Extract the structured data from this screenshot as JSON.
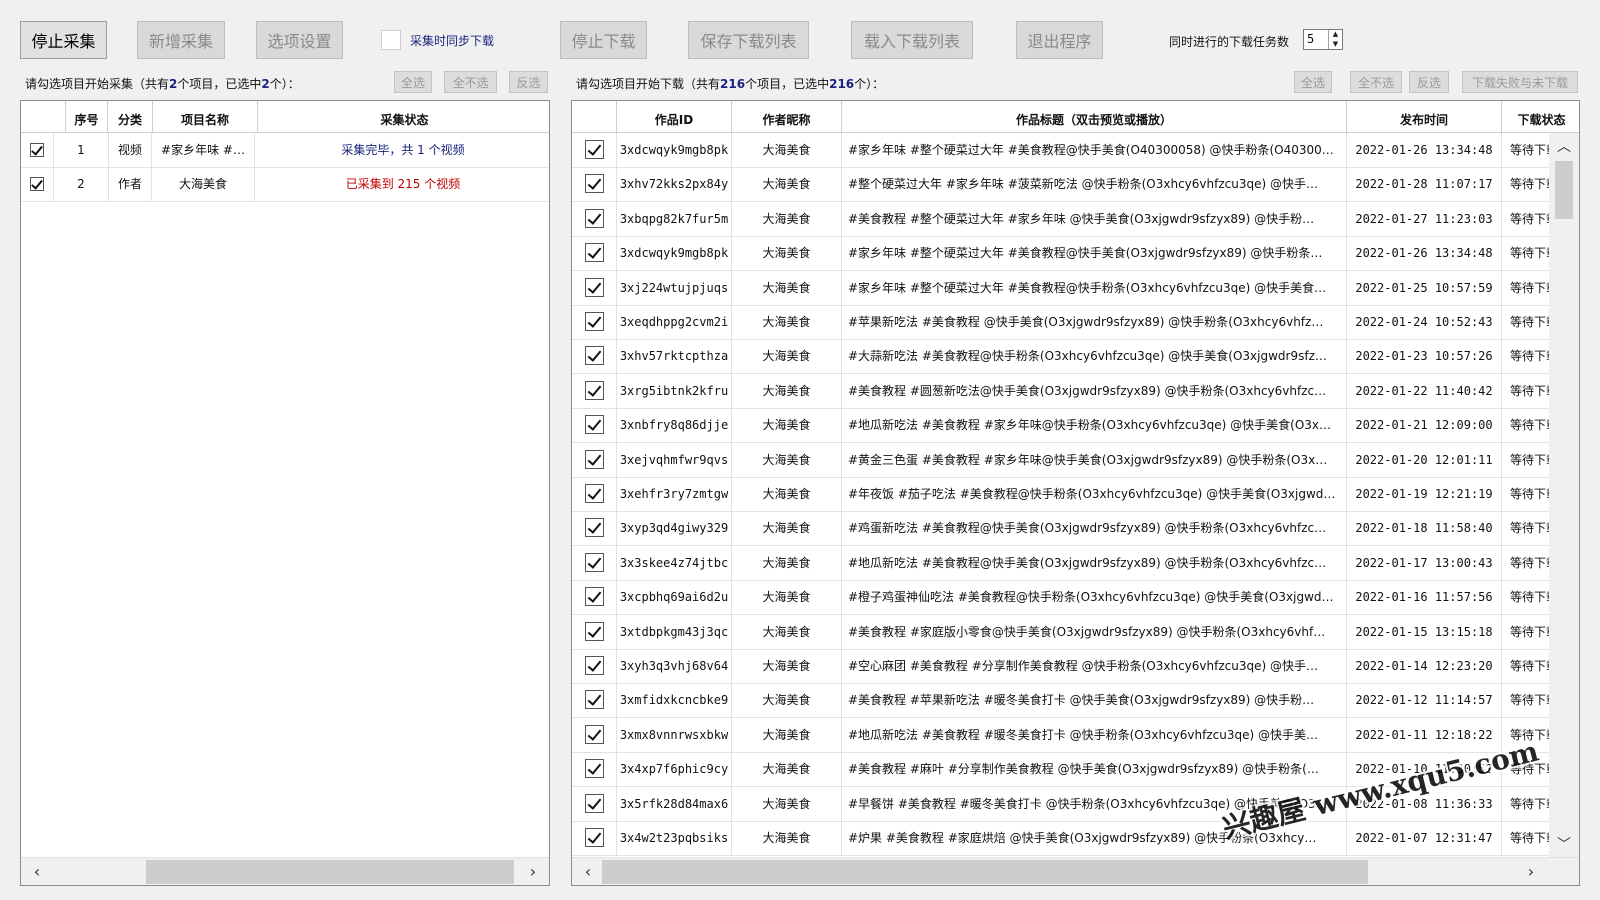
{
  "toolbar": {
    "stop_collect": "停止采集",
    "add_collect": "新增采集",
    "options": "选项设置",
    "sync_download_label": "采集时同步下载",
    "stop_download": "停止下载",
    "save_list": "保存下载列表",
    "load_list": "载入下载列表",
    "exit": "退出程序",
    "concurrent_label": "同时进行的下载任务数",
    "concurrent_value": "5"
  },
  "left": {
    "info_prefix": "请勾选项目开始采集（共有",
    "total": "2",
    "info_mid": "个项目，已选中",
    "selected": "2",
    "info_suffix": "个）：",
    "btn_all": "全选",
    "btn_none": "全不选",
    "btn_invert": "反选",
    "columns": [
      "序号",
      "分类",
      "项目名称",
      "采集状态"
    ],
    "rows": [
      {
        "no": "1",
        "cat": "视频",
        "name": "#家乡年味 #…",
        "status": "采集完毕，共 1 个视频",
        "status_color": "#1a237e"
      },
      {
        "no": "2",
        "cat": "作者",
        "name": "大海美食",
        "status": "已采集到 215 个视频",
        "status_color": "#c00000"
      }
    ]
  },
  "right": {
    "info_prefix": "请勾选项目开始下载（共有",
    "total": "216",
    "info_mid": "个项目，已选中",
    "selected": "216",
    "info_suffix": "个）：",
    "btn_all": "全选",
    "btn_none": "全不选",
    "btn_invert": "反选",
    "btn_retry": "下载失败与未下载",
    "columns": [
      "作品ID",
      "作者昵称",
      "作品标题（双击预览或播放）",
      "发布时间",
      "下载状态"
    ],
    "rows": [
      {
        "id": "3xdcwqyk9mgb8pk",
        "author": "大海美食",
        "title": "#家乡年味 #整个硬菜过大年 #美食教程@快手美食(O40300058) @快手粉条(O40300…",
        "time": "2022-01-26 13:34:48",
        "status": "等待下载"
      },
      {
        "id": "3xhv72kks2px84y",
        "author": "大海美食",
        "title": "#整个硬菜过大年 #家乡年味 #菠菜新吃法 @快手粉条(O3xhcy6vhfzcu3qe) @快手…",
        "time": "2022-01-28 11:07:17",
        "status": "等待下载"
      },
      {
        "id": "3xbqpg82k7fur5m",
        "author": "大海美食",
        "title": "#美食教程 #整个硬菜过大年 #家乡年味 @快手美食(O3xjgwdr9sfzyx89) @快手粉…",
        "time": "2022-01-27 11:23:03",
        "status": "等待下载"
      },
      {
        "id": "3xdcwqyk9mgb8pk",
        "author": "大海美食",
        "title": "#家乡年味 #整个硬菜过大年 #美食教程@快手美食(O3xjgwdr9sfzyx89) @快手粉条…",
        "time": "2022-01-26 13:34:48",
        "status": "等待下载"
      },
      {
        "id": "3xj224wtujpjuqs",
        "author": "大海美食",
        "title": "#家乡年味 #整个硬菜过大年 #美食教程@快手粉条(O3xhcy6vhfzcu3qe) @快手美食…",
        "time": "2022-01-25 10:57:59",
        "status": "等待下载"
      },
      {
        "id": "3xeqdhppg2cvm2i",
        "author": "大海美食",
        "title": "#苹果新吃法 #美食教程 @快手美食(O3xjgwdr9sfzyx89) @快手粉条(O3xhcy6vhfz…",
        "time": "2022-01-24 10:52:43",
        "status": "等待下载"
      },
      {
        "id": "3xhv57rktcpthza",
        "author": "大海美食",
        "title": "#大蒜新吃法 #美食教程@快手粉条(O3xhcy6vhfzcu3qe) @快手美食(O3xjgwdr9sfz…",
        "time": "2022-01-23 10:57:26",
        "status": "等待下载"
      },
      {
        "id": "3xrg5ibtnk2kfru",
        "author": "大海美食",
        "title": "#美食教程 #圆葱新吃法@快手美食(O3xjgwdr9sfzyx89) @快手粉条(O3xhcy6vhfzc…",
        "time": "2022-01-22 11:40:42",
        "status": "等待下载"
      },
      {
        "id": "3xnbfry8q86djje",
        "author": "大海美食",
        "title": "#地瓜新吃法 #美食教程 #家乡年味@快手粉条(O3xhcy6vhfzcu3qe) @快手美食(O3x…",
        "time": "2022-01-21 12:09:00",
        "status": "等待下载"
      },
      {
        "id": "3xejvqhmfwr9qvs",
        "author": "大海美食",
        "title": "#黄金三色蛋 #美食教程 #家乡年味@快手美食(O3xjgwdr9sfzyx89) @快手粉条(O3x…",
        "time": "2022-01-20 12:01:11",
        "status": "等待下载"
      },
      {
        "id": "3xehfr3ry7zmtgw",
        "author": "大海美食",
        "title": "#年夜饭 #茄子吃法 #美食教程@快手粉条(O3xhcy6vhfzcu3qe) @快手美食(O3xjgwd…",
        "time": "2022-01-19 12:21:19",
        "status": "等待下载"
      },
      {
        "id": "3xyp3qd4giwy329",
        "author": "大海美食",
        "title": "#鸡蛋新吃法 #美食教程@快手美食(O3xjgwdr9sfzyx89) @快手粉条(O3xhcy6vhfzc…",
        "time": "2022-01-18 11:58:40",
        "status": "等待下载"
      },
      {
        "id": "3x3skee4z74jtbc",
        "author": "大海美食",
        "title": "#地瓜新吃法 #美食教程@快手美食(O3xjgwdr9sfzyx89) @快手粉条(O3xhcy6vhfzc…",
        "time": "2022-01-17 13:00:43",
        "status": "等待下载"
      },
      {
        "id": "3xcpbhq69ai6d2u",
        "author": "大海美食",
        "title": "#橙子鸡蛋神仙吃法 #美食教程@快手粉条(O3xhcy6vhfzcu3qe) @快手美食(O3xjgwd…",
        "time": "2022-01-16 11:57:56",
        "status": "等待下载"
      },
      {
        "id": "3xtdbpkgm43j3qc",
        "author": "大海美食",
        "title": "#美食教程 #家庭版小零食@快手美食(O3xjgwdr9sfzyx89) @快手粉条(O3xhcy6vhf…",
        "time": "2022-01-15 13:15:18",
        "status": "等待下载"
      },
      {
        "id": "3xyh3q3vhj68v64",
        "author": "大海美食",
        "title": "#空心麻团 #美食教程 #分享制作美食教程 @快手粉条(O3xhcy6vhfzcu3qe) @快手…",
        "time": "2022-01-14 12:23:20",
        "status": "等待下载"
      },
      {
        "id": "3xmfidxkcncbke9",
        "author": "大海美食",
        "title": "#美食教程 #苹果新吃法 #暖冬美食打卡 @快手美食(O3xjgwdr9sfzyx89) @快手粉…",
        "time": "2022-01-12 11:14:57",
        "status": "等待下载"
      },
      {
        "id": "3xmx8vnnrwsxbkw",
        "author": "大海美食",
        "title": "#地瓜新吃法 #美食教程 #暖冬美食打卡 @快手粉条(O3xhcy6vhfzcu3qe) @快手美…",
        "time": "2022-01-11 12:18:22",
        "status": "等待下载"
      },
      {
        "id": "3x4xp7f6phic9cy",
        "author": "大海美食",
        "title": "#美食教程 #麻叶 #分享制作美食教程 @快手美食(O3xjgwdr9sfzyx89) @快手粉条(…",
        "time": "2022-01-10 11:30:52",
        "status": "等待下载"
      },
      {
        "id": "3x5rfk28d84max6",
        "author": "大海美食",
        "title": "#早餐饼 #美食教程 #暖冬美食打卡 @快手粉条(O3xhcy6vhfzcu3qe) @快手美食(O3…",
        "time": "2022-01-08 11:36:33",
        "status": "等待下载"
      },
      {
        "id": "3x4w2t23pqbsiks",
        "author": "大海美食",
        "title": "#炉果 #美食教程 #家庭烘焙 @快手美食(O3xjgwdr9sfzyx89) @快手粉条(O3xhcy…",
        "time": "2022-01-07 12:31:47",
        "status": "等待下载"
      }
    ]
  },
  "watermark": "兴趣屋 www.xqu5.com"
}
